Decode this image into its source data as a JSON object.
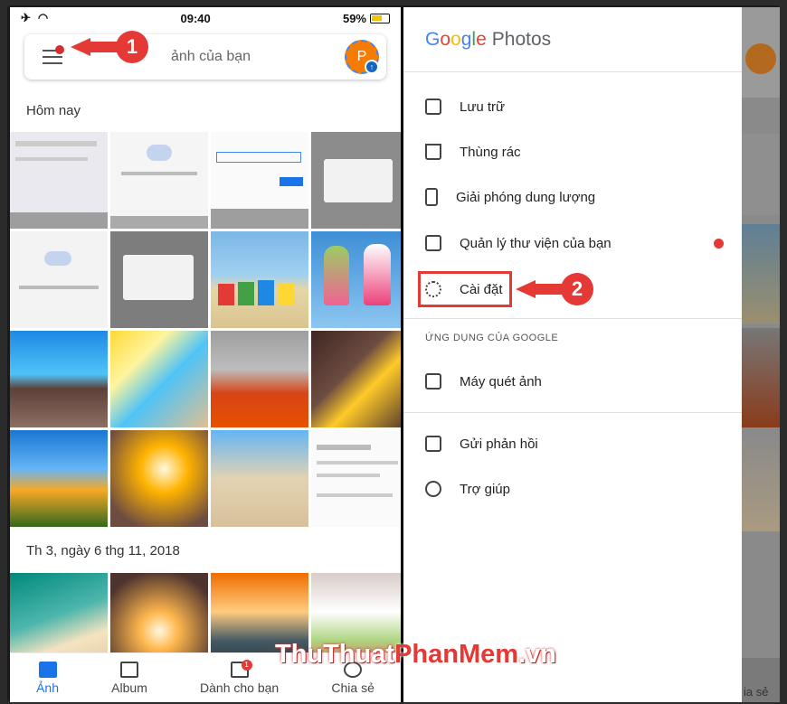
{
  "status": {
    "time": "09:40",
    "battery": "59%"
  },
  "search": {
    "placeholder": "ảnh của bạn",
    "avatar_letter": "P"
  },
  "callouts": {
    "one": "1",
    "two": "2"
  },
  "sections": {
    "today": "Hôm nay",
    "date": "Th 3, ngày 6 thg 11, 2018"
  },
  "bottom_nav": [
    {
      "label": "Ảnh",
      "icon": "photo-icon"
    },
    {
      "label": "Album",
      "icon": "album-icon"
    },
    {
      "label": "Dành cho bạn",
      "icon": "assistant-icon",
      "badge": "1"
    },
    {
      "label": "Chia sẻ",
      "icon": "share-icon"
    }
  ],
  "drawer": {
    "brand": {
      "google": "Google",
      "photos": "Photos"
    },
    "items": [
      {
        "label": "Lưu trữ",
        "icon": "archive-icon"
      },
      {
        "label": "Thùng rác",
        "icon": "trash-icon"
      },
      {
        "label": "Giải phóng dung lượng",
        "icon": "free-space-icon"
      },
      {
        "label": "Quản lý thư viện của bạn",
        "icon": "library-icon"
      },
      {
        "label": "Cài đặt",
        "icon": "gear-icon"
      }
    ],
    "subheader": "ỨNG DỤNG CỦA GOOGLE",
    "apps": [
      {
        "label": "Máy quét ảnh",
        "icon": "photoscan-icon"
      }
    ],
    "footer": [
      {
        "label": "Gửi phản hồi",
        "icon": "feedback-icon"
      },
      {
        "label": "Trợ giúp",
        "icon": "help-icon"
      }
    ]
  },
  "edge": {
    "nav_label": "ia sẻ"
  },
  "watermark": {
    "part1": "ThuThuat",
    "part2": "PhanMem",
    "part3": ".vn"
  },
  "colors": {
    "accent_blue": "#1a73e8",
    "highlight_red": "#e53935"
  }
}
